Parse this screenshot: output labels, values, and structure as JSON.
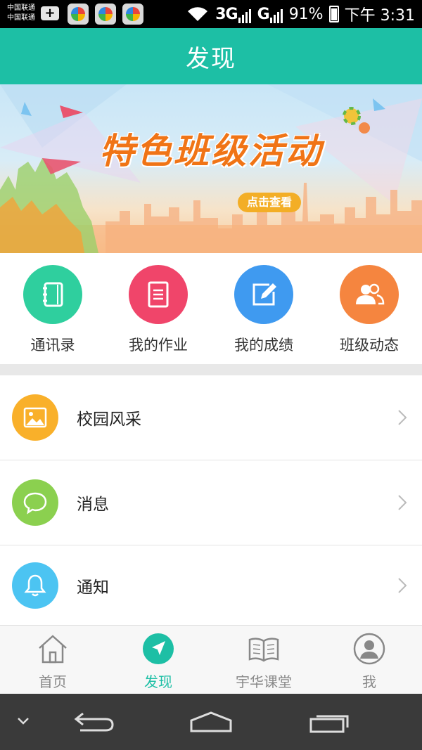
{
  "status_bar": {
    "carrier_1": "中国联通",
    "carrier_2": "中国联通",
    "network_1": "3G",
    "sim_1": "1",
    "network_2": "G",
    "sim_2": "2",
    "battery": "91%",
    "time": "下午 3:31"
  },
  "app_bar": {
    "title": "发现"
  },
  "banner": {
    "title": "特色班级活动",
    "button": "点击查看"
  },
  "quick_actions": [
    {
      "label": "通讯录",
      "icon": "contacts-book-icon",
      "color": "#2fcf9e"
    },
    {
      "label": "我的作业",
      "icon": "homework-document-icon",
      "color": "#f0456a"
    },
    {
      "label": "我的成绩",
      "icon": "edit-grades-icon",
      "color": "#3f9af0"
    },
    {
      "label": "班级动态",
      "icon": "class-people-icon",
      "color": "#f5853f"
    }
  ],
  "list": [
    {
      "label": "校园风采",
      "icon": "picture-icon",
      "color": "#f9b02a"
    },
    {
      "label": "消息",
      "icon": "chat-bubble-icon",
      "color": "#8bd04f"
    },
    {
      "label": "通知",
      "icon": "bell-icon",
      "color": "#4cc4f2"
    }
  ],
  "bottom_nav": [
    {
      "label": "首页",
      "icon": "home-icon"
    },
    {
      "label": "发现",
      "icon": "compass-navigation-icon",
      "active": true
    },
    {
      "label": "宇华课堂",
      "icon": "open-book-icon"
    },
    {
      "label": "我",
      "icon": "user-avatar-icon"
    }
  ],
  "colors": {
    "brand": "#1dbfa5",
    "banner_title": "#f07416",
    "banner_button": "#f3ae26"
  }
}
